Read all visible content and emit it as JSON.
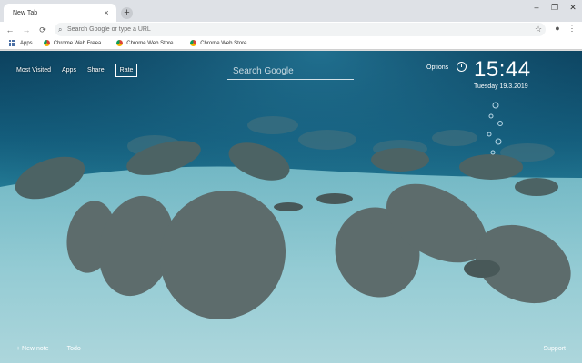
{
  "browser": {
    "tab_title": "New Tab",
    "tab_close_glyph": "×",
    "new_tab_glyph": "+",
    "window_controls": [
      "–",
      "❐",
      "✕"
    ],
    "omnibox_placeholder": "Search Google or type a URL",
    "bookmarks": [
      {
        "label": "Apps",
        "icon": "apps-grid-icon"
      },
      {
        "label": "Chrome Web Freea...",
        "icon": "chrome-icon"
      },
      {
        "label": "Chrome Web Store ...",
        "icon": "chrome-icon"
      },
      {
        "label": "Chrome Web Store ...",
        "icon": "chrome-icon"
      }
    ]
  },
  "newtab": {
    "nav": [
      "Most Visited",
      "Apps",
      "Share",
      "Rate"
    ],
    "search_placeholder": "Search Google",
    "options_label": "Options",
    "time": "15:44",
    "date": "Tuesday  19.3.2019",
    "new_note": "+ New note",
    "todo": "Todo",
    "support": "Support"
  },
  "colors": {
    "water_top": "#0b3f5c",
    "water_mid": "#2a87a0",
    "sand": "#a9d3d8",
    "manatee": "#5d6c6c"
  }
}
